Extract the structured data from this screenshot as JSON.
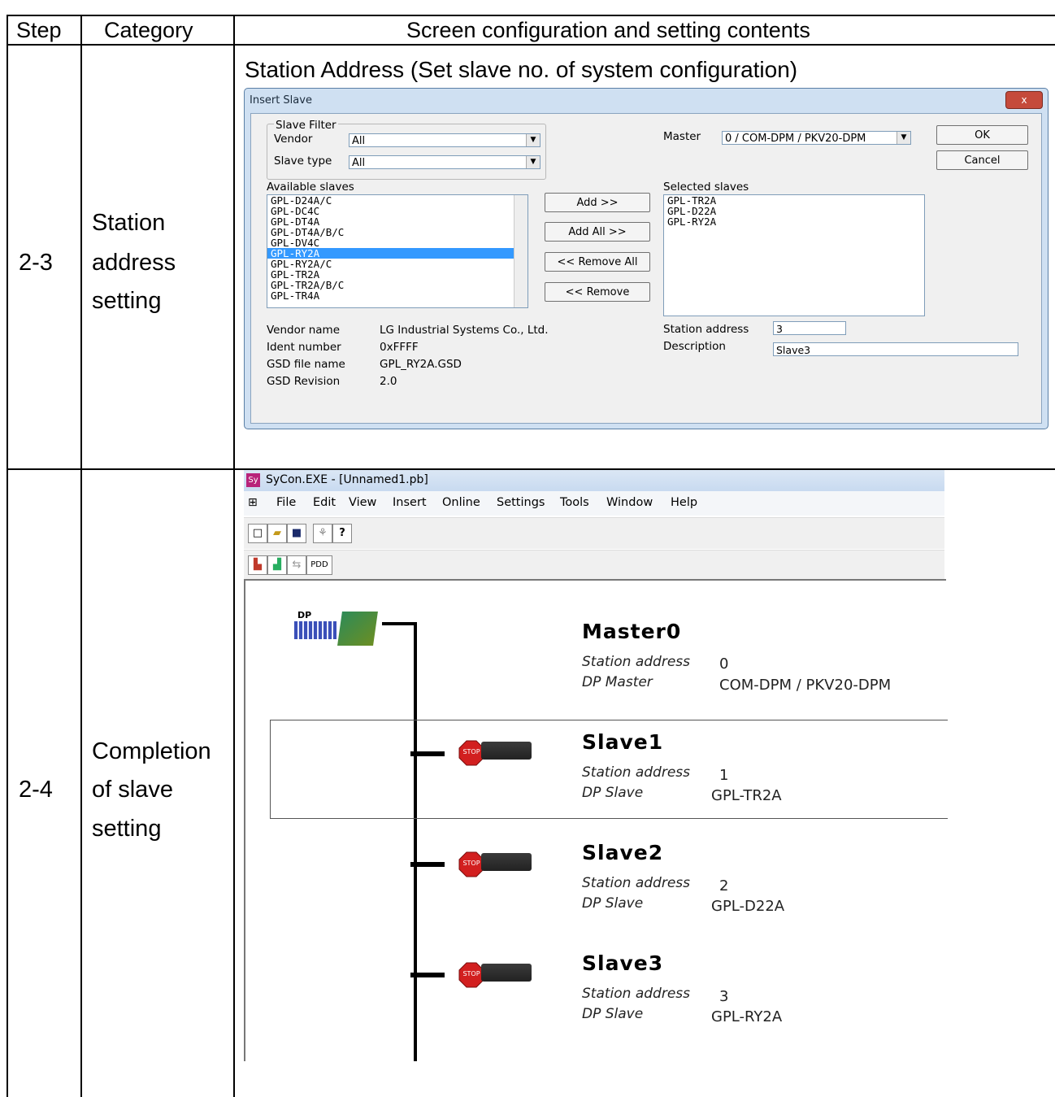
{
  "table": {
    "headers": {
      "step": "Step",
      "category": "Category",
      "content": "Screen configuration and setting contents"
    },
    "rows": [
      {
        "step": "2-3",
        "category_lines": [
          "Station",
          "address",
          "setting"
        ],
        "heading": "Station Address (Set slave no. of system configuration)"
      },
      {
        "step": "2-4",
        "category_lines": [
          "Completion",
          "of slave",
          "setting"
        ]
      }
    ]
  },
  "dialog": {
    "title": "Insert Slave",
    "close_label": "x",
    "filter_group": "Slave Filter",
    "vendor_label": "Vendor",
    "vendor_value": "All",
    "slave_type_label": "Slave type",
    "slave_type_value": "All",
    "master_label": "Master",
    "master_value": "0 / COM-DPM / PKV20-DPM",
    "ok_label": "OK",
    "cancel_label": "Cancel",
    "available_label": "Available slaves",
    "available": [
      "GPL-D24A/C",
      "GPL-DC4C",
      "GPL-DT4A",
      "GPL-DT4A/B/C",
      "GPL-DV4C",
      "GPL-RY2A",
      "GPL-RY2A/C",
      "GPL-TR2A",
      "GPL-TR2A/B/C",
      "GPL-TR4A"
    ],
    "selected_available": "GPL-RY2A",
    "add_label": "Add >>",
    "add_all_label": "Add All >>",
    "remove_all_label": "<< Remove All",
    "remove_label": "<< Remove",
    "selected_label": "Selected slaves",
    "selected": [
      "GPL-TR2A",
      "GPL-D22A",
      "GPL-RY2A"
    ],
    "vendor_name_label": "Vendor name",
    "vendor_name_value": "LG Industrial Systems Co., Ltd.",
    "ident_label": "Ident number",
    "ident_value": "0xFFFF",
    "gsd_label": "GSD file name",
    "gsd_value": "GPL_RY2A.GSD",
    "gsd_rev_label": "GSD Revision",
    "gsd_rev_value": "2.0",
    "station_address_label": "Station address",
    "station_address_value": "3",
    "description_label": "Description",
    "description_value": "Slave3"
  },
  "sycon": {
    "title": "SyCon.EXE - [Unnamed1.pb]",
    "menu": [
      "File",
      "Edit",
      "View",
      "Insert",
      "Online",
      "Settings",
      "Tools",
      "Window",
      "Help"
    ],
    "pdd_label": "PDD",
    "master": {
      "name": "Master0",
      "addr_label": "Station address",
      "addr": "0",
      "type_label": "DP Master",
      "type": "COM-DPM / PKV20-DPM",
      "logo_text": "DP"
    },
    "slaves": [
      {
        "name": "Slave1",
        "addr_label": "Station address",
        "addr": "1",
        "type_label": "DP Slave",
        "type": "GPL-TR2A",
        "stop": "STOP"
      },
      {
        "name": "Slave2",
        "addr_label": "Station address",
        "addr": "2",
        "type_label": "DP Slave",
        "type": "GPL-D22A",
        "stop": "STOP"
      },
      {
        "name": "Slave3",
        "addr_label": "Station address",
        "addr": "3",
        "type_label": "DP Slave",
        "type": "GPL-RY2A",
        "stop": "STOP"
      }
    ]
  }
}
